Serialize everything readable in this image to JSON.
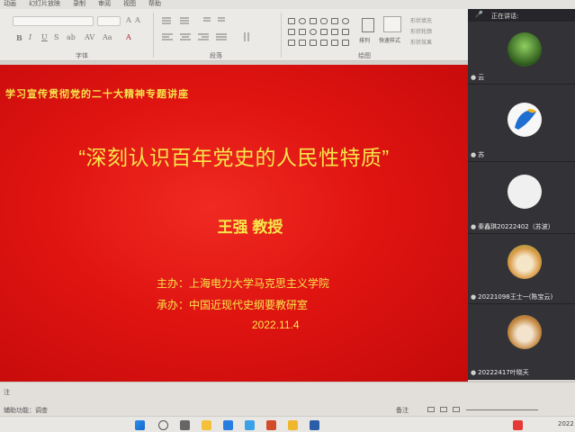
{
  "ribbon": {
    "tabs": [
      "动画",
      "幻灯片放映",
      "录制",
      "审阅",
      "视图",
      "帮助"
    ],
    "groups": {
      "font": "字体",
      "paragraph": "段落",
      "drawing": "绘图"
    },
    "format_buttons": [
      "B",
      "I",
      "U",
      "S",
      "ab",
      "AV",
      "Aa",
      "A"
    ],
    "arrange_label": "排列",
    "quick_styles_label": "快速样式",
    "shape_options": [
      "形状填充",
      "形状轮廓",
      "形状效果"
    ]
  },
  "slide": {
    "header": "学习宣传贯彻党的二十大精神专题讲座",
    "title": "“深刻认识百年党史的人民性特质”",
    "speaker": "王强 教授",
    "host": "主办：上海电力大学马克思主义学院",
    "co_host": "承办：中国近现代史纲要教研室",
    "date": "2022.11.4"
  },
  "meeting": {
    "speaking_label": "正在讲话:",
    "participants": [
      {
        "name": "云",
        "avatar": "forest-avatar",
        "color": "#3f7a2a"
      },
      {
        "name": "苏",
        "avatar": "blue-logo-avatar",
        "color": "#1f6fd0"
      },
      {
        "name": "秦鑫琪20222402（苏波）",
        "avatar": "sketch-avatar",
        "color": "#efefef"
      },
      {
        "name": "20221098王士一(陈宝云)",
        "avatar": "dog-avatar",
        "color": "#e0a047"
      },
      {
        "name": "20222417叶晓天",
        "avatar": "dog2-avatar",
        "color": "#c88740"
      }
    ]
  },
  "statusbar": {
    "left_text": "注",
    "notes_label": "备注",
    "accessibility": "辅助功能：调查"
  },
  "taskbar": {
    "date_fragment": "2022"
  }
}
